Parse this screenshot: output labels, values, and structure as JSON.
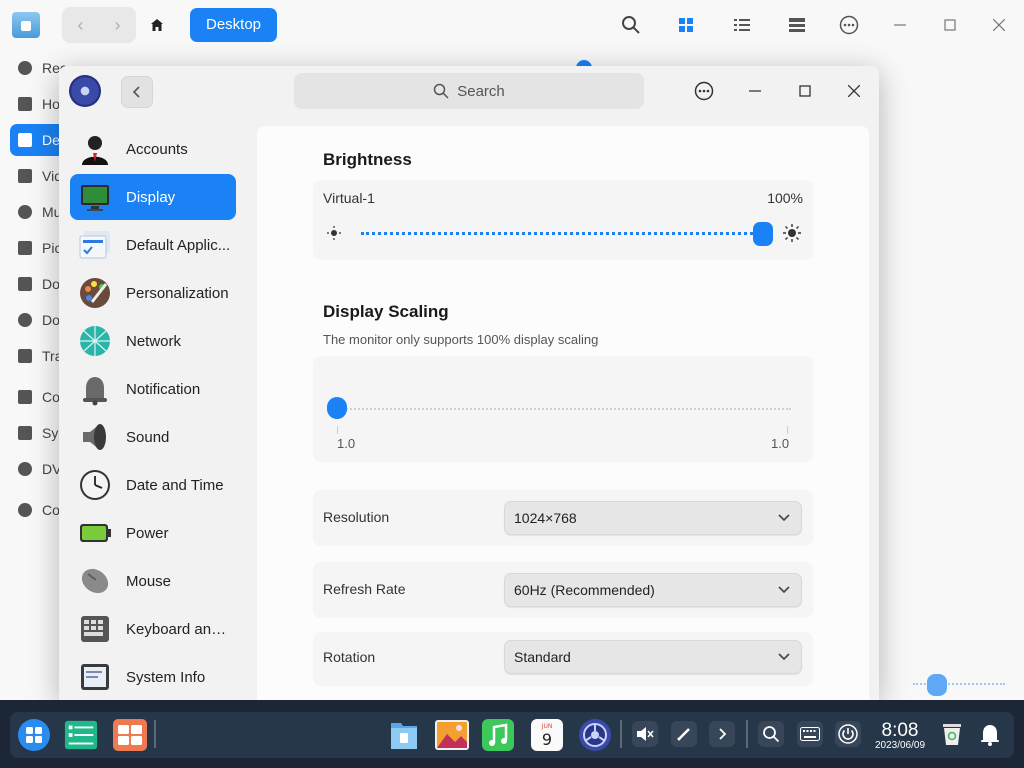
{
  "file_manager": {
    "breadcrumb": "Desktop",
    "sidebar": [
      {
        "label": "Recent",
        "icon": "clock-icon"
      },
      {
        "label": "Home",
        "icon": "home-icon"
      },
      {
        "label": "Desktop",
        "icon": "desktop-icon",
        "active": true
      },
      {
        "label": "Videos",
        "icon": "video-icon"
      },
      {
        "label": "Music",
        "icon": "music-icon"
      },
      {
        "label": "Pictures",
        "icon": "picture-icon"
      },
      {
        "label": "Documents",
        "icon": "document-icon"
      },
      {
        "label": "Downloads",
        "icon": "download-icon"
      },
      {
        "label": "Trash",
        "icon": "trash-icon"
      },
      {
        "label": "Computer",
        "icon": "computer-icon"
      },
      {
        "label": "System Disk",
        "icon": "disk-icon"
      },
      {
        "label": "DVD",
        "icon": "dvd-icon"
      },
      {
        "label": "Computers in LAN",
        "icon": "network-icon"
      }
    ]
  },
  "settings": {
    "search_placeholder": "Search",
    "nav": [
      {
        "label": "Accounts",
        "icon": "accounts-icon"
      },
      {
        "label": "Display",
        "icon": "display-icon",
        "active": true
      },
      {
        "label": "Default Applic...",
        "icon": "default-apps-icon"
      },
      {
        "label": "Personalization",
        "icon": "personalization-icon"
      },
      {
        "label": "Network",
        "icon": "network-icon"
      },
      {
        "label": "Notification",
        "icon": "notification-bell-icon"
      },
      {
        "label": "Sound",
        "icon": "sound-icon"
      },
      {
        "label": "Date and Time",
        "icon": "clock-icon"
      },
      {
        "label": "Power",
        "icon": "battery-icon"
      },
      {
        "label": "Mouse",
        "icon": "mouse-icon"
      },
      {
        "label": "Keyboard and ...",
        "icon": "keyboard-icon"
      },
      {
        "label": "System Info",
        "icon": "system-info-icon"
      }
    ],
    "brightness": {
      "title": "Brightness",
      "monitor": "Virtual-1",
      "value_label": "100%",
      "value": 1.0
    },
    "scaling": {
      "title": "Display Scaling",
      "note": "The monitor only supports 100% display scaling",
      "min_label": "1.0",
      "max_label": "1.0",
      "value": 0.0
    },
    "resolution": {
      "label": "Resolution",
      "value": "1024×768"
    },
    "refresh_rate": {
      "label": "Refresh Rate",
      "value": "60Hz (Recommended)"
    },
    "rotation": {
      "label": "Rotation",
      "value": "Standard"
    }
  },
  "taskbar": {
    "time": "8:08",
    "date": "2023/06/09",
    "calendar_day": "9",
    "calendar_month": "JUN"
  },
  "colors": {
    "accent": "#1a82f4",
    "taskbar": "#1c2636"
  }
}
